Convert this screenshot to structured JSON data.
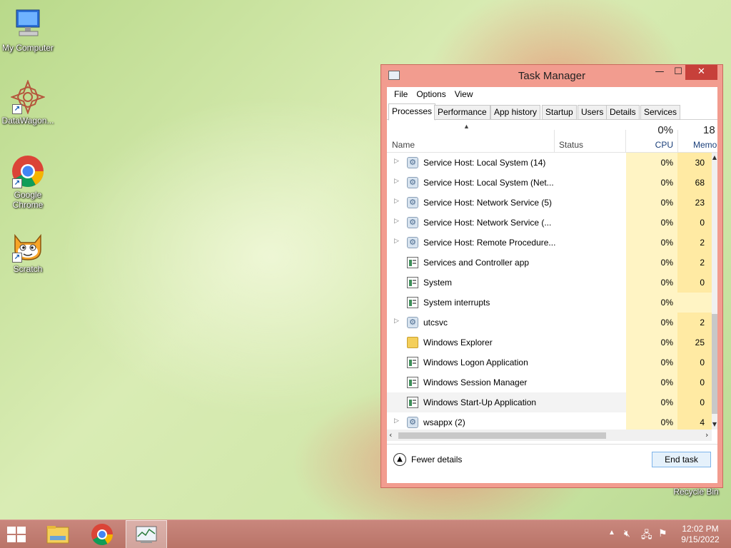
{
  "desktop": {
    "icons": [
      {
        "label": "My Computer"
      },
      {
        "label": "DataWagon..."
      },
      {
        "label": "Google Chrome"
      },
      {
        "label": "Scratch"
      },
      {
        "label": "Recycle Bin"
      }
    ]
  },
  "window": {
    "title": "Task Manager",
    "controls": {
      "minimize": "—",
      "maximize": "☐",
      "close": "✕"
    }
  },
  "menu": [
    "File",
    "Options",
    "View"
  ],
  "tabs": [
    "Processes",
    "Performance",
    "App history",
    "Startup",
    "Users",
    "Details",
    "Services"
  ],
  "active_tab": "Processes",
  "columns": {
    "name": "Name",
    "status": "Status",
    "cpu_pct": "0%",
    "cpu": "CPU",
    "mem_pct": "18",
    "mem": "Memo"
  },
  "processes": [
    {
      "name": "Service Host: Local System (14)",
      "cpu": "0%",
      "mem": "30",
      "icon": "gear-icon",
      "expandable": true
    },
    {
      "name": "Service Host: Local System (Net...",
      "cpu": "0%",
      "mem": "68",
      "icon": "gear-icon",
      "expandable": true
    },
    {
      "name": "Service Host: Network Service (5)",
      "cpu": "0%",
      "mem": "23",
      "icon": "gear-icon",
      "expandable": true
    },
    {
      "name": "Service Host: Network Service (...",
      "cpu": "0%",
      "mem": "0",
      "icon": "gear-icon",
      "expandable": true
    },
    {
      "name": "Service Host: Remote Procedure...",
      "cpu": "0%",
      "mem": "2",
      "icon": "gear-icon",
      "expandable": true
    },
    {
      "name": "Services and Controller app",
      "cpu": "0%",
      "mem": "2",
      "icon": "window-app-icon",
      "expandable": false
    },
    {
      "name": "System",
      "cpu": "0%",
      "mem": "0",
      "icon": "window-app-icon",
      "expandable": false
    },
    {
      "name": "System interrupts",
      "cpu": "0%",
      "mem": "",
      "icon": "window-app-icon",
      "expandable": false
    },
    {
      "name": "utcsvc",
      "cpu": "0%",
      "mem": "2",
      "icon": "gear-icon",
      "expandable": true
    },
    {
      "name": "Windows Explorer",
      "cpu": "0%",
      "mem": "25",
      "icon": "folder-icon",
      "expandable": false
    },
    {
      "name": "Windows Logon Application",
      "cpu": "0%",
      "mem": "0",
      "icon": "window-app-icon",
      "expandable": false
    },
    {
      "name": "Windows Session Manager",
      "cpu": "0%",
      "mem": "0",
      "icon": "window-app-icon",
      "expandable": false
    },
    {
      "name": "Windows Start-Up Application",
      "cpu": "0%",
      "mem": "0",
      "icon": "window-app-icon",
      "expandable": false,
      "highlighted": true
    },
    {
      "name": "wsappx (2)",
      "cpu": "0%",
      "mem": "4",
      "icon": "gear-icon",
      "expandable": true
    }
  ],
  "footer": {
    "fewer_details": "Fewer details",
    "end_task": "End task"
  },
  "taskbar": {
    "time": "12:02 PM",
    "date": "9/15/2022"
  }
}
